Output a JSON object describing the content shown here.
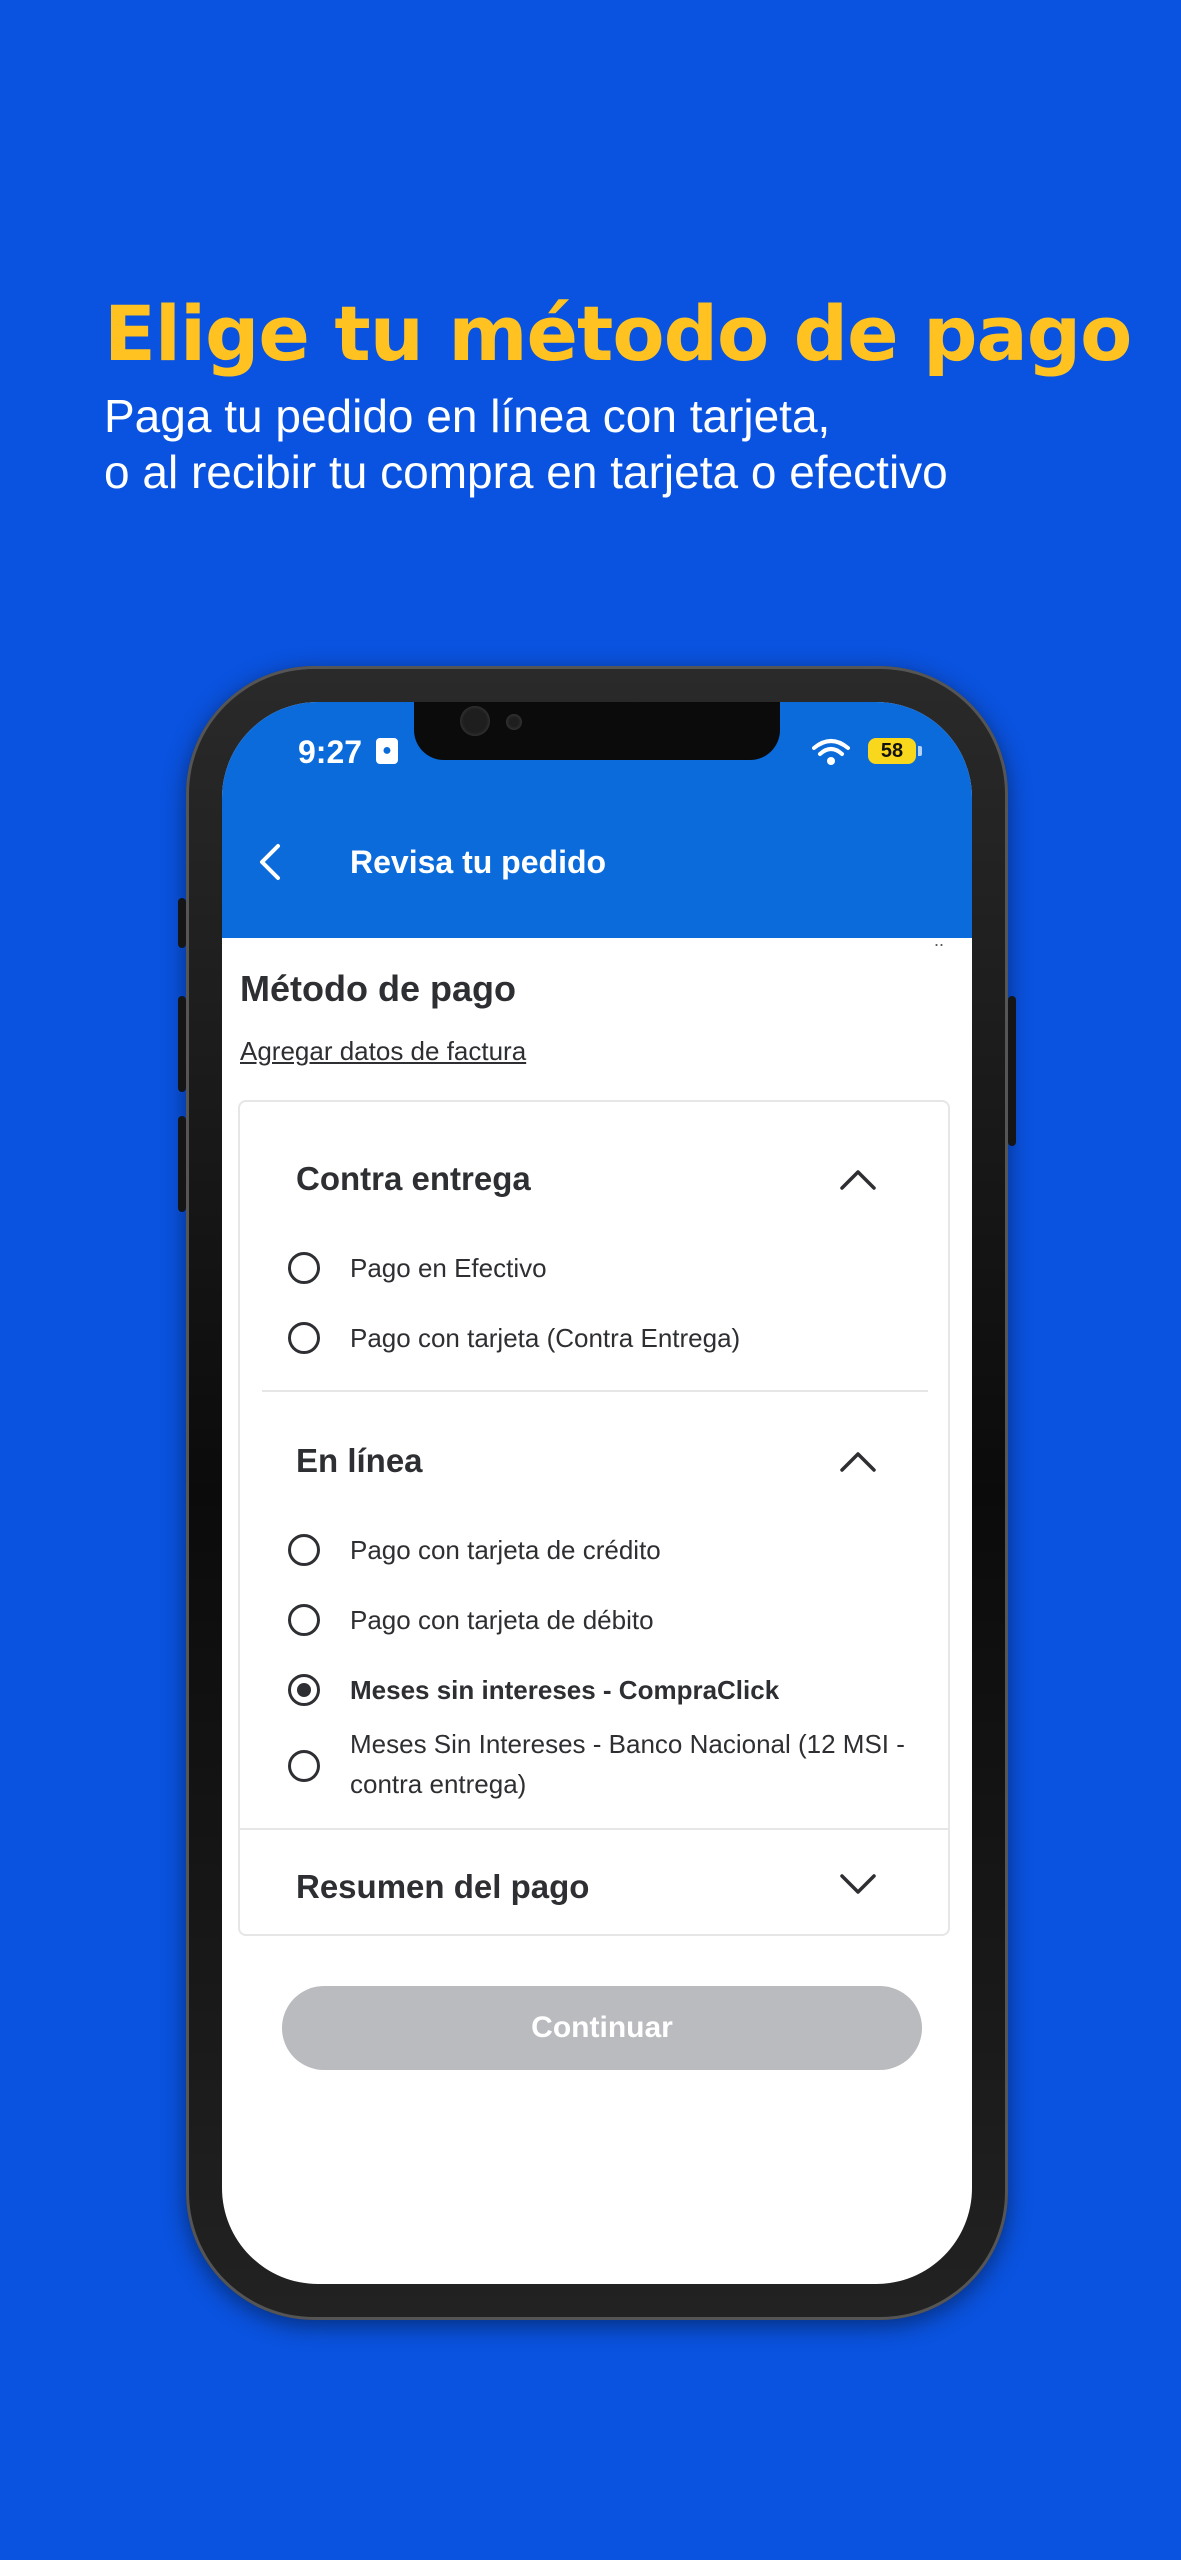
{
  "promo": {
    "title": "Elige tu método de pago",
    "subtitle_line1": "Paga tu pedido en línea con tarjeta,",
    "subtitle_line2": "o al recibir tu compra en tarjeta o efectivo"
  },
  "status_bar": {
    "time": "9:27",
    "battery": "58"
  },
  "header": {
    "title": "Revisa tu pedido",
    "back_icon": "chevron-left-icon"
  },
  "peek_text": "..",
  "payment": {
    "section_title": "Método de pago",
    "invoice_link": "Agregar datos de factura",
    "groups": [
      {
        "title": "Contra entrega",
        "expanded": true,
        "options": [
          {
            "label": "Pago en Efectivo",
            "selected": false
          },
          {
            "label": "Pago con tarjeta (Contra Entrega)",
            "selected": false
          }
        ]
      },
      {
        "title": "En línea",
        "expanded": true,
        "options": [
          {
            "label": "Pago con tarjeta de crédito",
            "selected": false
          },
          {
            "label": "Pago con tarjeta de débito",
            "selected": false
          },
          {
            "label": "Meses sin intereses - CompraClick",
            "selected": true
          },
          {
            "label": "Meses Sin Intereses - Banco Nacional (12 MSI - contra entrega)",
            "selected": false
          }
        ]
      }
    ],
    "summary_title": "Resumen del pago",
    "summary_expanded": false
  },
  "continue_button": {
    "label": "Continuar",
    "enabled": false
  },
  "colors": {
    "background": "#0A53E0",
    "promo_title": "#FFC220",
    "header": "#0B6BDA",
    "button_disabled": "#BABBBE",
    "battery": "#F9D71C"
  }
}
